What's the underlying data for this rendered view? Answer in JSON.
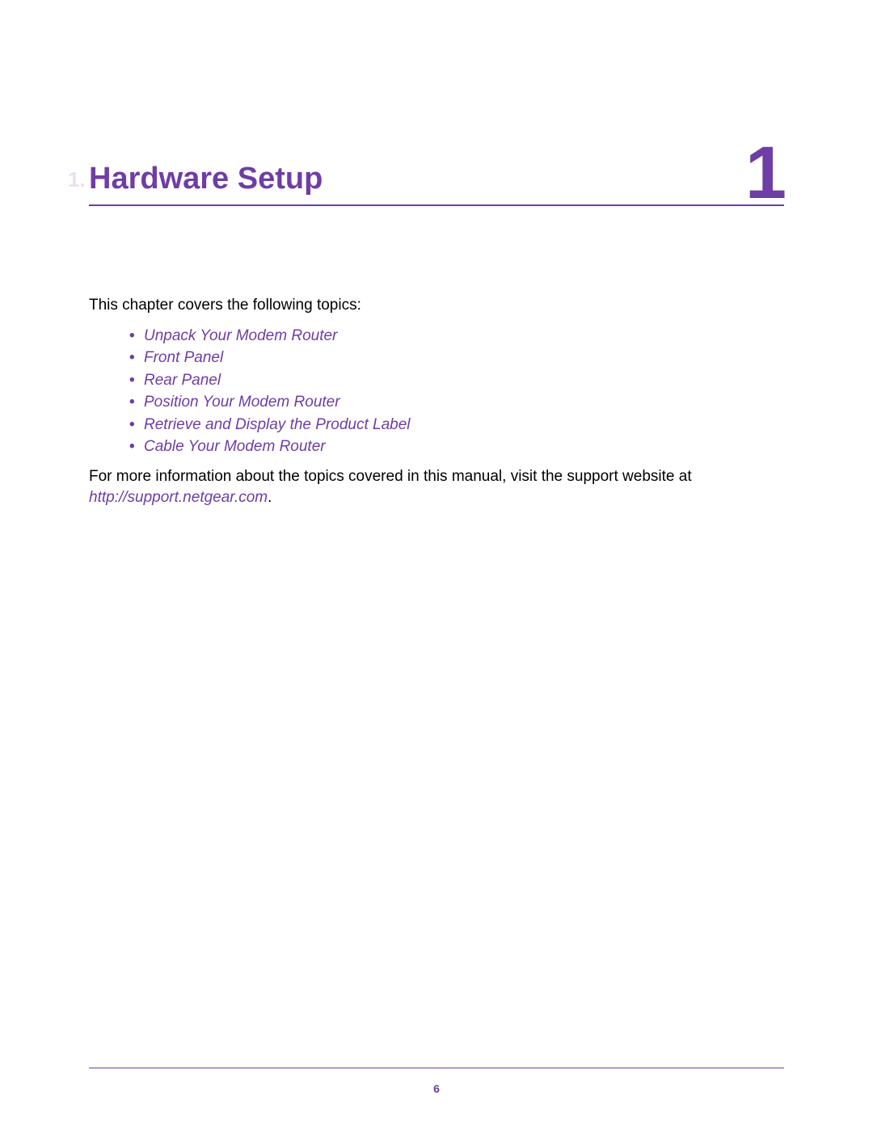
{
  "chapter": {
    "side_tab": "1.",
    "title": "Hardware Setup",
    "number": "1"
  },
  "intro": "This chapter covers the following topics:",
  "topics": [
    "Unpack Your Modem Router",
    "Front Panel",
    "Rear Panel",
    "Position Your Modem Router",
    "Retrieve and Display the Product Label",
    "Cable Your Modem Router"
  ],
  "more_info_prefix": "For more information about the topics covered in this manual, visit the support website at ",
  "support_url": "http://support.netgear.com",
  "more_info_suffix": ".",
  "page_number": "6"
}
